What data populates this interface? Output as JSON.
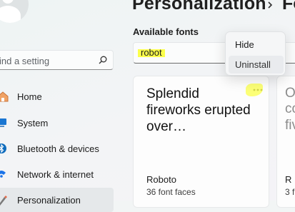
{
  "sidebar": {
    "search_placeholder": "ind a setting",
    "items": [
      {
        "label": "Home",
        "icon": "home-icon"
      },
      {
        "label": "System",
        "icon": "monitor-icon"
      },
      {
        "label": "Bluetooth & devices",
        "icon": "bluetooth-icon"
      },
      {
        "label": "Network & internet",
        "icon": "wifi-icon"
      },
      {
        "label": "Personalization",
        "icon": "brush-icon",
        "selected": true
      }
    ]
  },
  "header": {
    "title": "Personalization",
    "next_crumb": "Fo"
  },
  "fonts": {
    "section_label": "Available fonts",
    "search_value": "robot",
    "cards": [
      {
        "preview": "Splendid fireworks erupted over…",
        "name": "Roboto",
        "meta": "36 font faces"
      },
      {
        "preview_lines": [
          "Oi",
          "co",
          "fiv"
        ],
        "name": "R",
        "meta": "3 f"
      }
    ]
  },
  "context_menu": {
    "items": [
      "Hide",
      "Uninstall"
    ]
  },
  "colors": {
    "highlight": "#fbff55",
    "accent_blue": "#0f6cbd"
  }
}
